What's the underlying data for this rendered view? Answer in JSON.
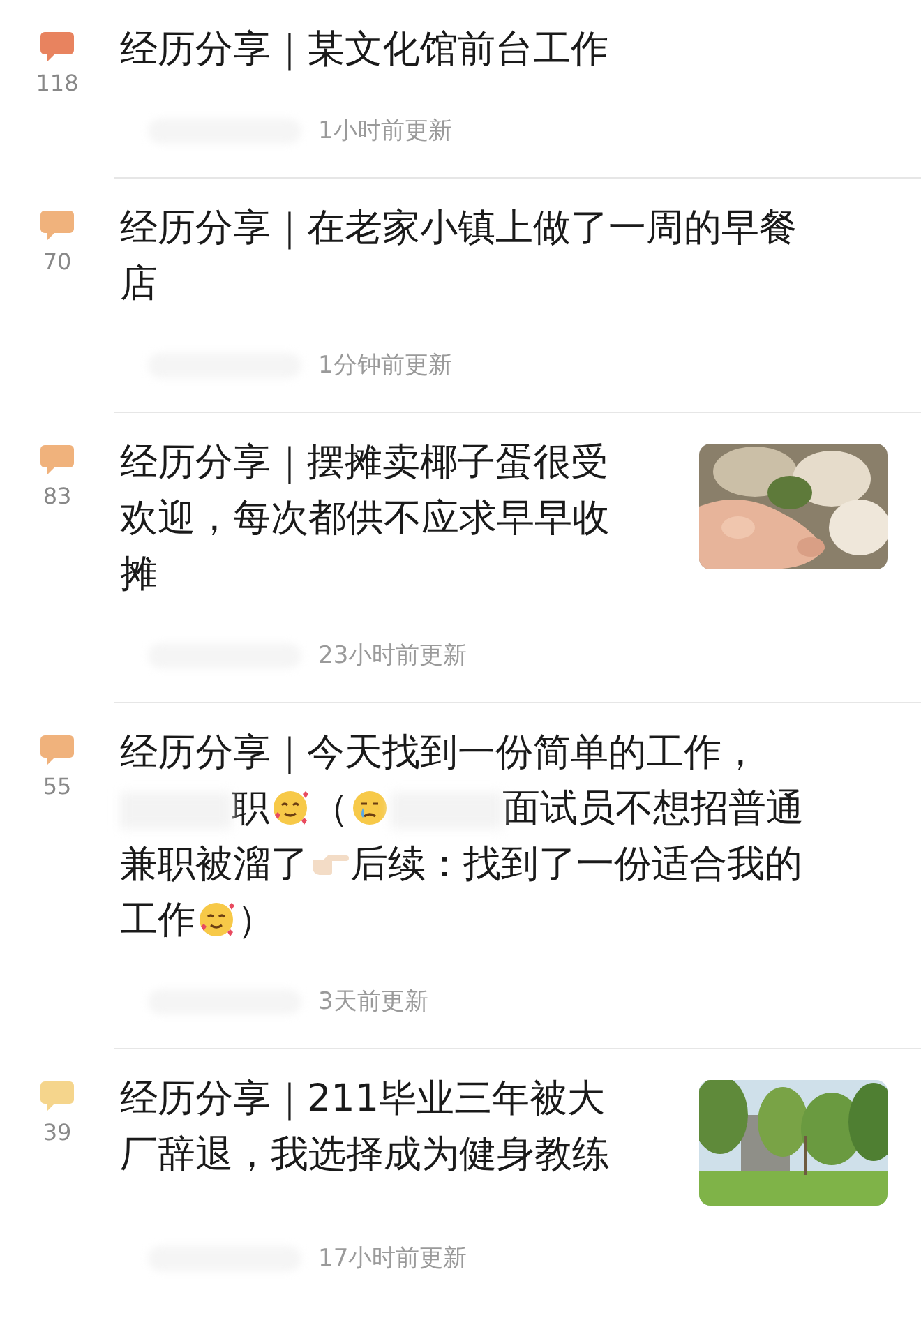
{
  "posts": [
    {
      "comments": "118",
      "color": "#e8835f",
      "parts": [
        {
          "kind": "text",
          "text": "经历分享｜某文化馆前台工作"
        }
      ],
      "meta": "1小时前更新"
    },
    {
      "comments": "70",
      "color": "#f0b27c",
      "parts": [
        {
          "kind": "text",
          "text": "经历分享｜在老家小镇上做了一周的早餐店"
        }
      ],
      "meta": "1分钟前更新"
    },
    {
      "comments": "83",
      "color": "#f0b27c",
      "parts": [
        {
          "kind": "text",
          "text": "经历分享｜摆摊卖椰子蛋很受欢迎，每次都供不应求早早收摊"
        }
      ],
      "meta": "23小时前更新"
    },
    {
      "comments": "55",
      "color": "#f0b27c",
      "parts": [
        {
          "kind": "text",
          "text": "经历分享｜今天找到一份简单的工作，"
        },
        {
          "kind": "blur"
        },
        {
          "kind": "text",
          "text": "职"
        },
        {
          "kind": "smile"
        },
        {
          "kind": "text",
          "text": "（"
        },
        {
          "kind": "cry"
        },
        {
          "kind": "blur"
        },
        {
          "kind": "text",
          "text": "面试员不想招普通"
        },
        {
          "kind": "text",
          "text": "兼职被溜了"
        },
        {
          "kind": "hand"
        },
        {
          "kind": "text",
          "text": "后续：找到了一份适合我的"
        },
        {
          "kind": "text",
          "text": "工作"
        },
        {
          "kind": "smile"
        },
        {
          "kind": "text",
          "text": "）"
        }
      ],
      "meta": "3天前更新"
    },
    {
      "comments": "39",
      "color": "#f5d58c",
      "parts": [
        {
          "kind": "text",
          "text": "经历分享｜211毕业三年被大厂辞退，我选择成为健身教练"
        }
      ],
      "meta": "17小时前更新"
    }
  ]
}
